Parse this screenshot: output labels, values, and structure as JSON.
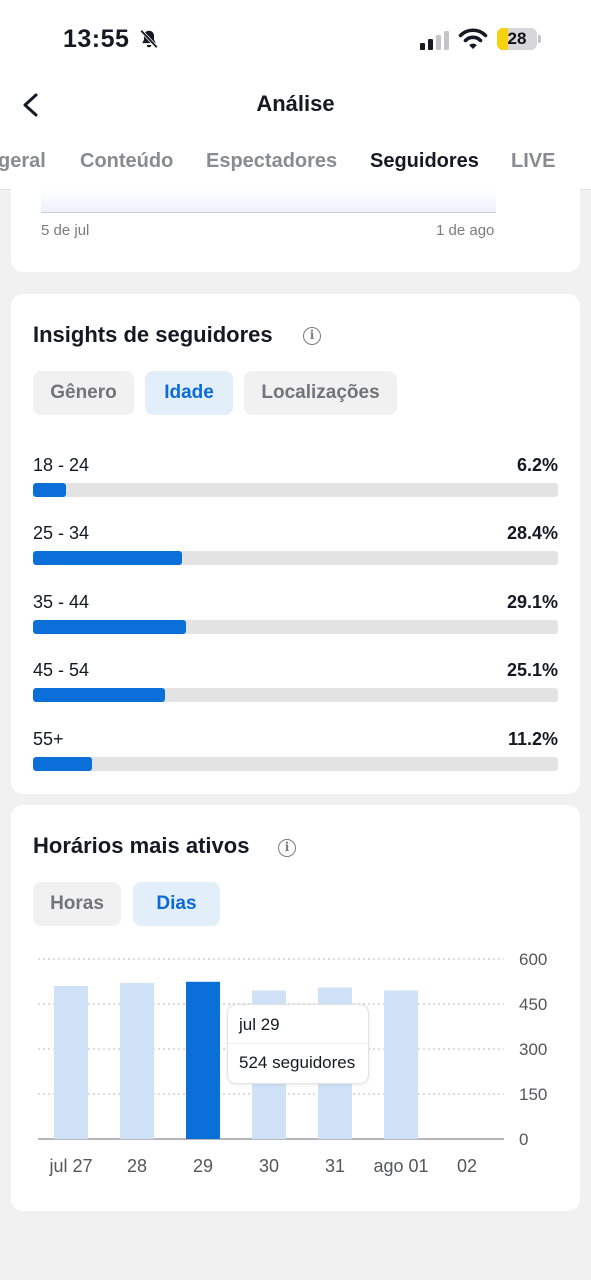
{
  "status_bar": {
    "time": "13:55",
    "battery": "28",
    "battery_level": 0.28,
    "icons": [
      "bell-mute-icon",
      "signal-icon",
      "wifi-icon",
      "battery-icon"
    ]
  },
  "nav": {
    "title": "Análise",
    "back_icon": "chevron-left-icon"
  },
  "tabs": [
    {
      "label": "geral",
      "active": false
    },
    {
      "label": "Conteúdo",
      "active": false
    },
    {
      "label": "Espectadores",
      "active": false
    },
    {
      "label": "Seguidores",
      "active": true
    },
    {
      "label": "LIVE",
      "active": false
    }
  ],
  "top_chart": {
    "start_date": "5 de jul",
    "end_date": "1 de ago"
  },
  "insights": {
    "title": "Insights de seguidores",
    "info_icon": "info-icon",
    "filters": [
      {
        "label": "Gênero",
        "active": false
      },
      {
        "label": "Idade",
        "active": true
      },
      {
        "label": "Localizações",
        "active": false
      }
    ],
    "age_groups": [
      {
        "label": "18 - 24",
        "percent_text": "6.2%",
        "percent": 6.2
      },
      {
        "label": "25 - 34",
        "percent_text": "28.4%",
        "percent": 28.4
      },
      {
        "label": "35 - 44",
        "percent_text": "29.1%",
        "percent": 29.1
      },
      {
        "label": "45 - 54",
        "percent_text": "25.1%",
        "percent": 25.1
      },
      {
        "label": "55+",
        "percent_text": "11.2%",
        "percent": 11.2
      }
    ]
  },
  "active_times": {
    "title": "Horários mais ativos",
    "info_icon": "info-icon",
    "filters": [
      {
        "label": "Horas",
        "active": false
      },
      {
        "label": "Dias",
        "active": true
      }
    ],
    "tooltip": {
      "date": "jul 29",
      "value": "524 seguidores"
    }
  },
  "chart_data": {
    "type": "bar",
    "categories": [
      "jul 27",
      "28",
      "29",
      "30",
      "31",
      "ago 01",
      "02"
    ],
    "values": [
      510,
      520,
      524,
      495,
      505,
      495,
      null
    ],
    "highlighted_index": 2,
    "ylim": [
      0,
      600
    ],
    "yticks": [
      "0",
      "150",
      "300",
      "450",
      "600"
    ],
    "y_axis_side": "right",
    "grid": true,
    "colors": {
      "bar": "#cfe2f8",
      "highlight": "#0a6fd8",
      "grid": "#b9b9bd",
      "axis": "#8a8b91"
    }
  }
}
